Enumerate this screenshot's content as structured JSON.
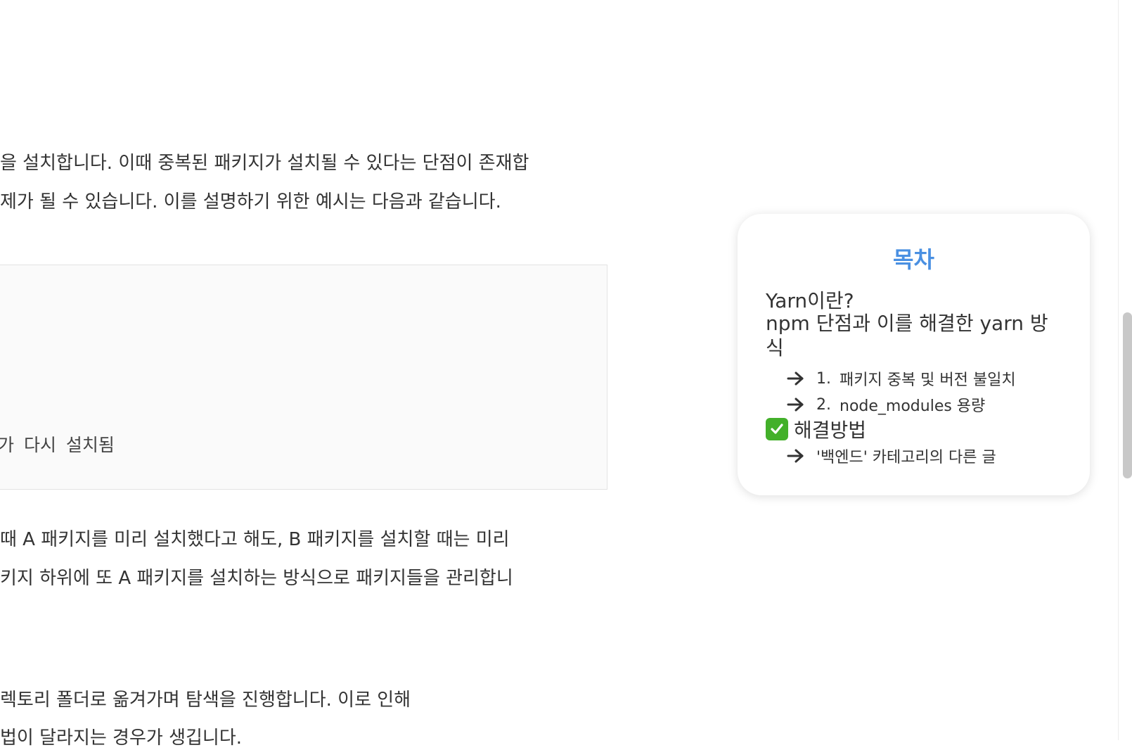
{
  "article": {
    "para1": [
      "을 설치합니다. 이때 중복된 패키지가 설치될 수 있다는 단점이 존재합",
      "제가 될 수 있습니다. 이를 설명하기 위한 예시는 다음과 같습니다."
    ],
    "code_block_line": "가  다시  설치됨",
    "para2": [
      " 때 A 패키지를 미리 설치했다고 해도, B 패키지를 설치할 때는 미리",
      "키지 하위에 또 A 패키지를 설치하는 방식으로 패키지들을 관리합니"
    ],
    "para3": [
      "렉토리 폴더로 옮겨가며 탐색을 진행합니다. 이로 인해",
      "법이 달라지는 경우가 생깁니다."
    ]
  },
  "toc": {
    "title": "목차",
    "items": [
      {
        "label": "Yarn이란?"
      },
      {
        "label": "npm 단점과 이를 해결한 yarn 방식"
      },
      {
        "number": "1.",
        "label": "패키지 중복 및 버전 불일치"
      },
      {
        "number": "2.",
        "label": "node_modules 용량"
      },
      {
        "label": "해결방법"
      },
      {
        "label": "'백엔드' 카테고리의 다른 글"
      }
    ]
  },
  "icons": {
    "toc_arrow": "arrow-right-icon",
    "checkmark": "check-mark-icon",
    "checkmark_color": "#43b02a",
    "accent": "#4a90e2"
  }
}
